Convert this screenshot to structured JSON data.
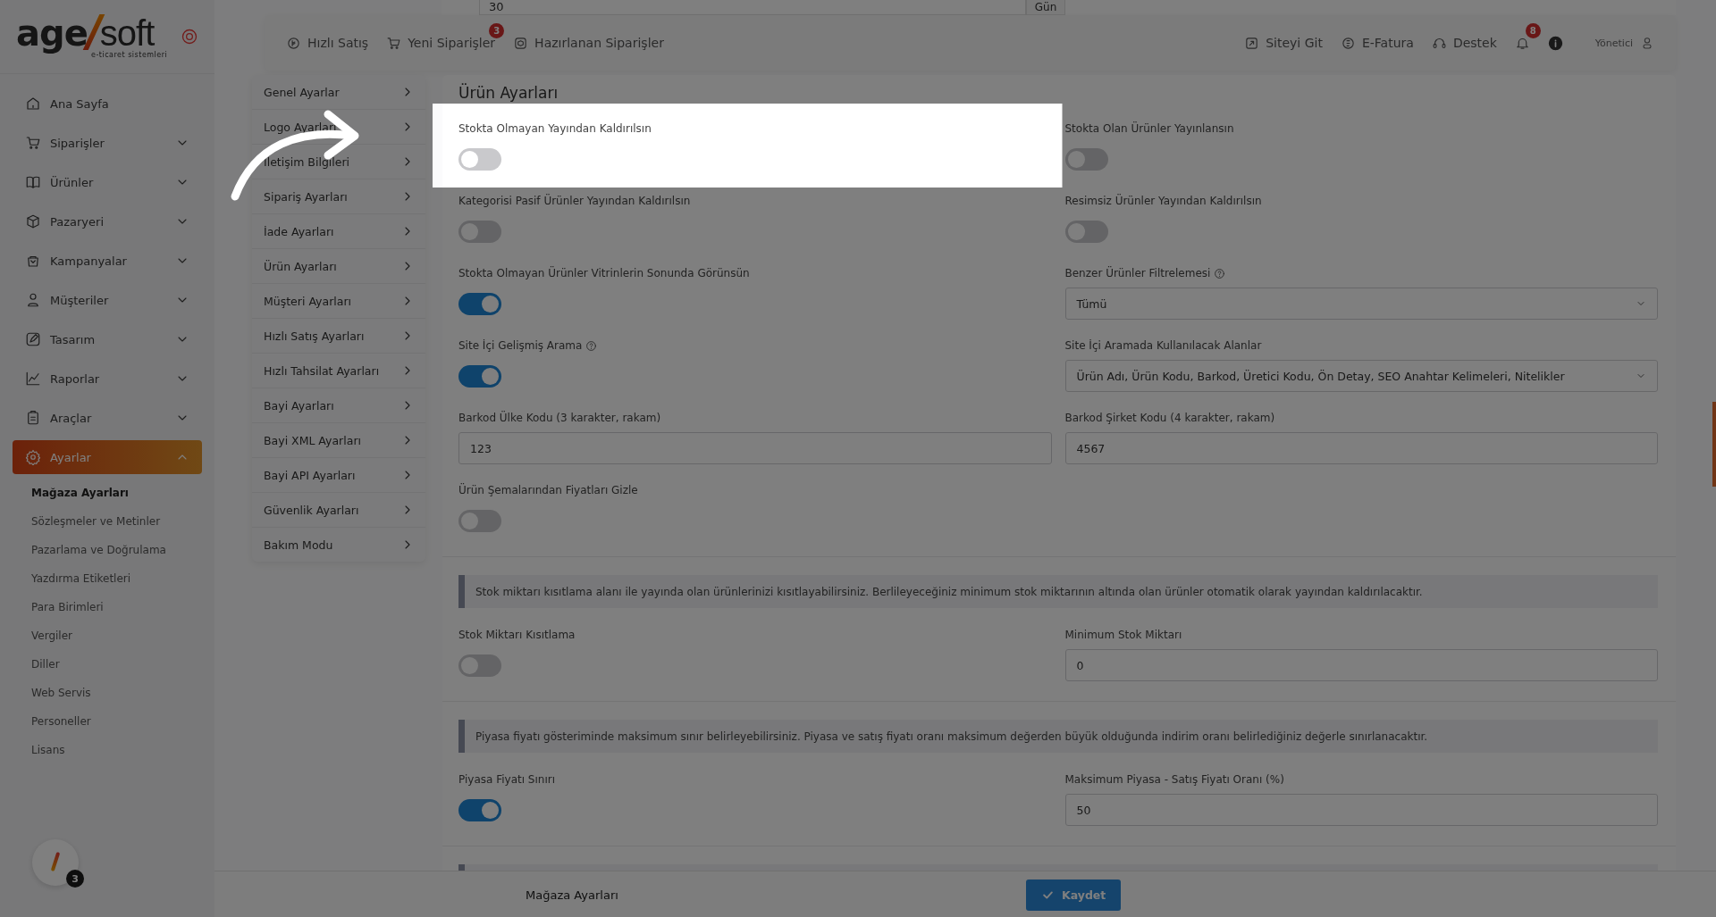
{
  "brand": {
    "name_bold": "age",
    "name_light": "soft",
    "tagline": "e-ticaret sistemleri"
  },
  "nav": [
    {
      "label": "Ana Sayfa",
      "selected": false
    },
    {
      "label": "Siparişler",
      "expanded": false,
      "selected": false
    },
    {
      "label": "Ürünler",
      "expanded": false,
      "selected": false
    },
    {
      "label": "Pazaryeri",
      "expanded": false,
      "selected": false
    },
    {
      "label": "Kampanyalar",
      "expanded": false,
      "selected": false
    },
    {
      "label": "Müşteriler",
      "expanded": false,
      "selected": false
    },
    {
      "label": "Tasarım",
      "expanded": false,
      "selected": false
    },
    {
      "label": "Raporlar",
      "expanded": false,
      "selected": false
    },
    {
      "label": "Araçlar",
      "expanded": false,
      "selected": false
    },
    {
      "label": "Ayarlar",
      "expanded": true,
      "selected": true,
      "children": [
        {
          "label": "Mağaza Ayarları",
          "selected": true
        },
        {
          "label": "Sözleşmeler ve Metinler",
          "selected": false
        },
        {
          "label": "Pazarlama ve Doğrulama",
          "selected": false
        },
        {
          "label": "Yazdırma Etiketleri",
          "selected": false
        },
        {
          "label": "Para Birimleri",
          "selected": false
        },
        {
          "label": "Vergiler",
          "selected": false
        },
        {
          "label": "Diller",
          "selected": false
        },
        {
          "label": "Web Servis",
          "selected": false
        },
        {
          "label": "Personeller",
          "selected": false
        },
        {
          "label": "Lisans",
          "selected": false
        }
      ]
    }
  ],
  "avatar_badge": "3",
  "background_field": {
    "value": "30",
    "addon": "Gün"
  },
  "topbar": {
    "left": [
      {
        "label": "Hızlı Satış"
      },
      {
        "label": "Yeni Siparişler",
        "badge": "3"
      },
      {
        "label": "Hazırlanan Siparişler"
      }
    ],
    "right": [
      {
        "label": "Siteyi Git"
      },
      {
        "label": "E-Fatura"
      },
      {
        "label": "Destek"
      }
    ],
    "notifications_badge": "8",
    "user": "Yönetici"
  },
  "settings_menu": [
    {
      "label": "Genel Ayarlar"
    },
    {
      "label": "Logo Ayarları"
    },
    {
      "label": "İletişim Bilgileri"
    },
    {
      "label": "Sipariş Ayarları"
    },
    {
      "label": "İade Ayarları"
    },
    {
      "label": "Ürün Ayarları"
    },
    {
      "label": "Müşteri Ayarları"
    },
    {
      "label": "Hızlı Satış Ayarları"
    },
    {
      "label": "Hızlı Tahsilat Ayarları"
    },
    {
      "label": "Bayi Ayarları"
    },
    {
      "label": "Bayi XML Ayarları"
    },
    {
      "label": "Bayi API Ayarları"
    },
    {
      "label": "Güvenlik Ayarları"
    },
    {
      "label": "Bakım Modu"
    }
  ],
  "panel": {
    "title": "Ürün Ayarları",
    "sections": [
      {
        "fields": [
          {
            "kind": "toggle",
            "label": "Stokta Olmayan Yayından Kaldırılsın",
            "on": false,
            "spotlight": true
          },
          {
            "kind": "toggle",
            "label": "Stokta Olan Ürünler Yayınlansın",
            "on": false
          },
          {
            "kind": "toggle",
            "label": "Kategorisi Pasif Ürünler Yayından Kaldırılsın",
            "on": false
          },
          {
            "kind": "toggle",
            "label": "Resimsiz Ürünler Yayından Kaldırılsın",
            "on": false
          },
          {
            "kind": "toggle",
            "label": "Stokta Olmayan Ürünler Vitrinlerin Sonunda Görünsün",
            "on": true
          },
          {
            "kind": "select",
            "label": "Benzer Ürünler Filtrelemesi",
            "help": true,
            "value": "Tümü"
          },
          {
            "kind": "toggle",
            "label": "Site İçi Gelişmiş Arama",
            "help": true,
            "on": true
          },
          {
            "kind": "select",
            "label": "Site İçi Aramada Kullanılacak Alanlar",
            "value": "Ürün Adı, Ürün Kodu, Barkod, Üretici Kodu, Ön Detay, SEO Anahtar Kelimeleri, Nitelikler"
          },
          {
            "kind": "input",
            "label": "Barkod Ülke Kodu (3 karakter, rakam)",
            "value": "123"
          },
          {
            "kind": "input",
            "label": "Barkod Şirket Kodu (4 karakter, rakam)",
            "value": "4567"
          },
          {
            "kind": "toggle",
            "label": "Ürün Şemalarından Fiyatları Gizle",
            "on": false
          }
        ]
      },
      {
        "info": "Stok miktarı kısıtlama alanı ile yayında olan ürünlerinizi kısıtlayabilirsiniz. Berlileyeceğiniz minimum stok miktarının altında olan ürünler otomatik olarak yayından kaldırılacaktır.",
        "fields": [
          {
            "kind": "toggle",
            "label": "Stok Miktarı Kısıtlama",
            "on": false
          },
          {
            "kind": "input",
            "label": "Minimum Stok Miktarı",
            "value": "0"
          }
        ]
      },
      {
        "info": "Piyasa fiyatı gösteriminde maksimum sınır belirleyebilirsiniz. Piyasa ve satış fiyatı oranı maksimum değerden büyük olduğunda indirim oranı belirlediğiniz değerle sınırlanacaktır.",
        "fields": [
          {
            "kind": "toggle",
            "label": "Piyasa Fiyatı Sınırı",
            "on": true
          },
          {
            "kind": "input",
            "label": "Maksimum Piyasa - Satış Fiyatı Oranı (%)",
            "value": "50"
          }
        ]
      }
    ]
  },
  "footer": {
    "title": "Mağaza Ayarları",
    "save": "Kaydet"
  },
  "overlay": {
    "dimmed": true
  }
}
